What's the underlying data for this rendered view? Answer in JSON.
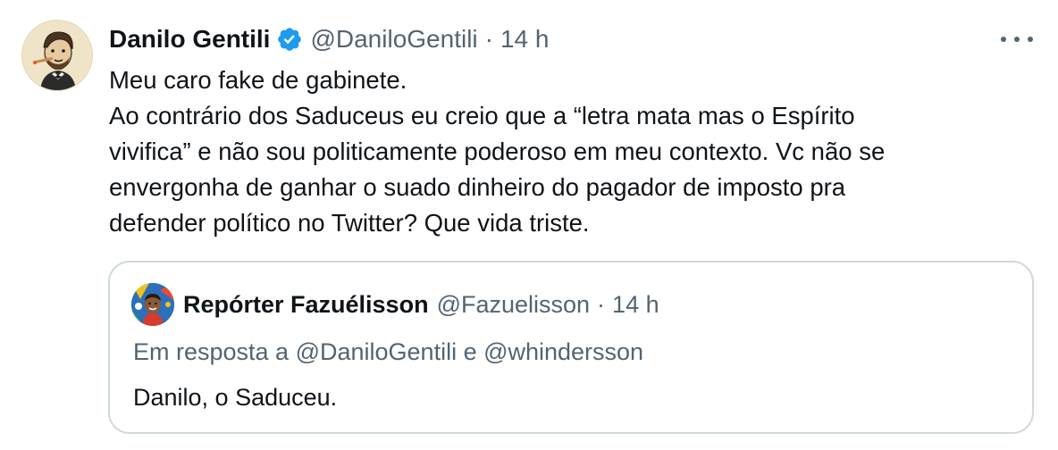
{
  "tweet": {
    "author": {
      "name": "Danilo Gentili",
      "handle": "@DaniloGentili",
      "verified": true,
      "avatar_icon": "caricature-avatar"
    },
    "separator": "·",
    "time": "14 h",
    "more_icon": "more-dots-icon",
    "text_lines": [
      "Meu caro fake de gabinete.",
      "Ao contrário dos Saduceus eu creio que a “letra mata mas o Espírito",
      "vivifica” e não sou politicamente poderoso em meu contexto. Vc não se",
      "envergonha de ganhar o suado dinheiro do pagador de imposto pra",
      "defender político no Twitter? Que vida triste."
    ]
  },
  "quoted_tweet": {
    "author": {
      "name": "Repórter Fazuélisson",
      "handle": "@Fazuelisson",
      "avatar_icon": "colorful-avatar"
    },
    "separator": "·",
    "time": "14 h",
    "reply_to": "Em resposta a @DaniloGentili e @whindersson",
    "text": "Danilo, o Saduceu."
  },
  "colors": {
    "text_primary": "#0f1419",
    "text_secondary": "#536471",
    "verified_blue": "#1d9bf0",
    "quote_border": "#cfd9de"
  }
}
